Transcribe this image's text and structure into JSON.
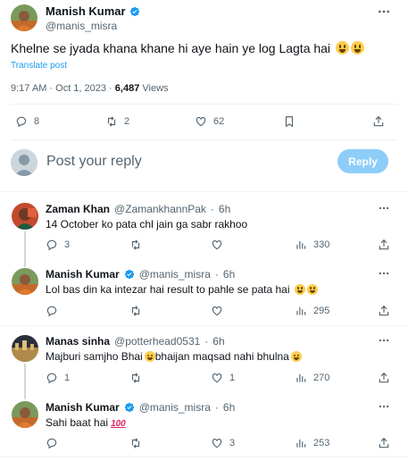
{
  "main_tweet": {
    "author_name": "Manish Kumar",
    "author_handle": "@manis_misra",
    "text": "Khelne se jyada khana khane hi aye hain ye log Lagta hai",
    "translate": "Translate post",
    "time": "9:17 AM · Oct 1, 2023 · ",
    "views_count": "6,487",
    "views_label": "Views",
    "replies": "8",
    "reposts": "2",
    "likes": "62"
  },
  "compose": {
    "placeholder": "Post your reply",
    "button": "Reply"
  },
  "replies": [
    {
      "name": "Zaman Khan",
      "handle": "@ZamankhannPak",
      "time": "6h",
      "text": "14 October ko pata chl jain ga sabr rakhoo",
      "replies": "3",
      "reposts": "",
      "likes": "",
      "views": "330"
    },
    {
      "name": "Manish Kumar",
      "handle": "@manis_misra",
      "time": "6h",
      "text": "Lol bas din ka intezar hai result to pahle se pata hai",
      "replies": "",
      "reposts": "",
      "likes": "",
      "views": "295"
    },
    {
      "name": "Manas sinha",
      "handle": "@potterhead0531",
      "time": "6h",
      "text_a": "Majburi samjho Bhai",
      "text_b": "bhaijan maqsad nahi bhulna",
      "replies": "1",
      "reposts": "",
      "likes": "1",
      "views": "270"
    },
    {
      "name": "Manish Kumar",
      "handle": "@manis_misra",
      "time": "6h",
      "text": "Sahi baat hai",
      "replies": "",
      "reposts": "",
      "likes": "3",
      "views": "253"
    }
  ],
  "sep": "·",
  "colors": {
    "accent": "#1d9bf0",
    "reply_button": "#8ecdf8",
    "muted": "#536471"
  },
  "icons": [
    "verified-badge-icon",
    "more-icon",
    "reply-icon",
    "repost-icon",
    "like-icon",
    "bookmark-icon",
    "share-icon",
    "views-icon"
  ]
}
